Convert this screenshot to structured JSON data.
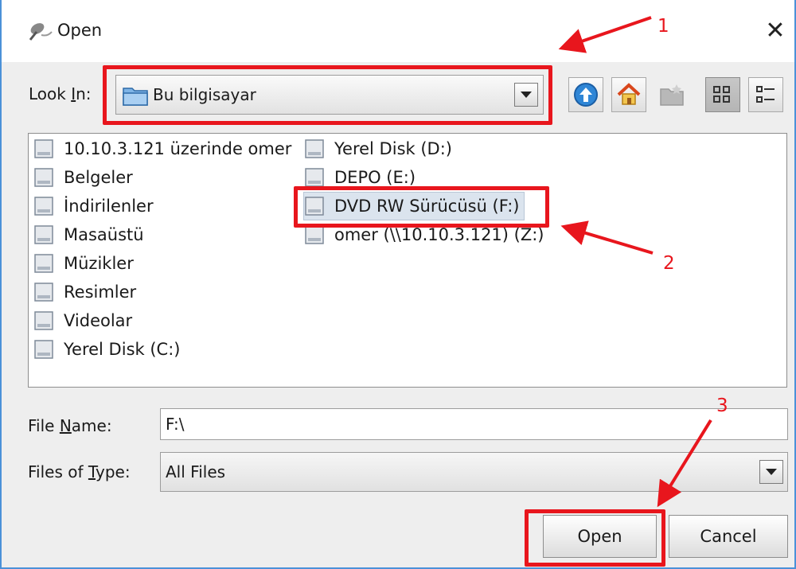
{
  "window": {
    "title": "Open",
    "close_glyph": "✕"
  },
  "lookin": {
    "label_pre": "Look ",
    "label_mnemonic": "I",
    "label_post": "n:",
    "value": "Bu bilgisayar"
  },
  "toolbar": {
    "icons": [
      "up-one-level-icon",
      "home-icon",
      "create-new-folder-icon",
      "list-view-icon",
      "details-view-icon"
    ]
  },
  "files": {
    "column1": [
      "10.10.3.121 üzerinde omer",
      "Belgeler",
      "İndirilenler",
      "Masaüstü",
      "Müzikler",
      "Resimler",
      "Videolar",
      "Yerel Disk (C:)"
    ],
    "column2": [
      "Yerel Disk (D:)",
      "DEPO (E:)",
      "DVD RW Sürücüsü (F:)",
      "omer (\\\\10.10.3.121) (Z:)"
    ],
    "selected": "DVD RW Sürücüsü (F:)"
  },
  "filename": {
    "label_pre": "File ",
    "label_mnemonic": "N",
    "label_post": "ame:",
    "value": "F:\\"
  },
  "filetype": {
    "label_pre": "Files of ",
    "label_mnemonic": "T",
    "label_post": "ype:",
    "value": "All Files"
  },
  "buttons": {
    "open": "Open",
    "cancel": "Cancel"
  },
  "annotations": {
    "numbers": [
      "1",
      "2",
      "3"
    ],
    "color": "#e8161d"
  },
  "colors": {
    "window_border": "#4b91d8",
    "selection": "#dbe4ee",
    "annotation": "#e8161d"
  }
}
